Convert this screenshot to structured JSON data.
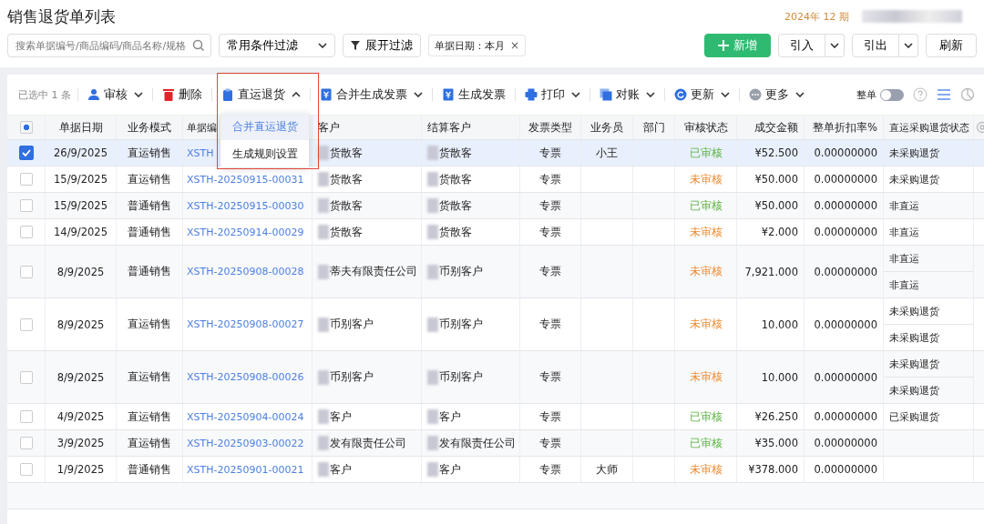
{
  "title": "销售退货单列表",
  "period": "2024年 12 期",
  "search": {
    "placeholder": "搜索单据编号/商品编码/商品名称/规格"
  },
  "filter_select": "常用条件过滤",
  "expand_filter": "展开过滤",
  "filter_tag": "单据日期：本月",
  "tag_close": "×",
  "buttons": [
    {
      "label": "新增",
      "kind": "primary"
    },
    {
      "label": "引入",
      "kind": "split"
    },
    {
      "label": "引出",
      "kind": "split"
    },
    {
      "label": "刷新",
      "kind": "plain"
    }
  ],
  "selection_count": "已选中 1 条",
  "actions": [
    {
      "label": "审核",
      "dropdown": true,
      "expanded": false
    },
    {
      "label": "删除",
      "dropdown": false
    },
    {
      "label": "直运退货",
      "dropdown": true,
      "expanded": true
    },
    {
      "label": "合并生成发票",
      "dropdown": true,
      "expanded": false
    },
    {
      "label": "生成发票",
      "dropdown": false
    },
    {
      "label": "打印",
      "dropdown": true,
      "expanded": false
    },
    {
      "label": "对账",
      "dropdown": true,
      "expanded": false
    },
    {
      "label": "更新",
      "dropdown": true,
      "expanded": false
    },
    {
      "label": "更多",
      "dropdown": true,
      "expanded": false
    }
  ],
  "whole_toggle": {
    "label": "整单",
    "on": false
  },
  "menu": [
    {
      "label": "合并直运退货",
      "selected": true
    },
    {
      "label": "生成规则设置",
      "selected": false
    }
  ],
  "select_all": {
    "indeterminate": true
  },
  "columns": [
    "单据日期",
    "业务模式",
    "单据编",
    "客户",
    "结算客户",
    "发票类型",
    "业务员",
    "部门",
    "审核状态",
    "成交金额",
    "整单折扣率%",
    "直运采购退货状态"
  ],
  "rows": [
    {
      "checked": true,
      "date": "26/9/2025",
      "mode": "直运销售",
      "number": "XSTH",
      "customer": "货散客",
      "settle": "货散客",
      "invoice": "专票",
      "salesman": "小王",
      "audit": "已审核",
      "audited": true,
      "amount": "¥52.500",
      "discount": "0.00000000",
      "return_status": [
        "未采购退货"
      ]
    },
    {
      "checked": false,
      "date": "15/9/2025",
      "mode": "直运销售",
      "number": "XSTH-20250915-00031",
      "customer": "货散客",
      "settle": "货散客",
      "invoice": "专票",
      "audit": "未审核",
      "audited": false,
      "amount": "¥50.000",
      "discount": "0.00000000",
      "return_status": [
        "未采购退货"
      ]
    },
    {
      "checked": false,
      "date": "15/9/2025",
      "mode": "普通销售",
      "number": "XSTH-20250915-00030",
      "customer": "货散客",
      "settle": "货散客",
      "invoice": "专票",
      "audit": "已审核",
      "audited": true,
      "amount": "¥50.000",
      "discount": "0.00000000",
      "return_status": [
        "非直运"
      ]
    },
    {
      "checked": false,
      "date": "14/9/2025",
      "mode": "普通销售",
      "number": "XSTH-20250914-00029",
      "customer": "货散客",
      "settle": "货散客",
      "invoice": "专票",
      "audit": "未审核",
      "audited": false,
      "amount": "¥2.000",
      "discount": "0.00000000",
      "return_status": [
        "非直运"
      ]
    },
    {
      "checked": false,
      "date": "8/9/2025",
      "mode": "普通销售",
      "number": "XSTH-20250908-00028",
      "customer": "蒂夫有限责任公司",
      "settle": "币别客户",
      "invoice": "专票",
      "audit": "未审核",
      "audited": false,
      "amount": "7,921.000",
      "discount": "0.00000000",
      "return_status": [
        "非直运",
        "非直运"
      ]
    },
    {
      "checked": false,
      "date": "8/9/2025",
      "mode": "直运销售",
      "number": "XSTH-20250908-00027",
      "customer": "币别客户",
      "settle": "币别客户",
      "invoice": "专票",
      "audit": "未审核",
      "audited": false,
      "amount": "10.000",
      "discount": "0.00000000",
      "return_status": [
        "未采购退货",
        "未采购退货"
      ]
    },
    {
      "checked": false,
      "date": "8/9/2025",
      "mode": "直运销售",
      "number": "XSTH-20250908-00026",
      "customer": "币别客户",
      "settle": "币别客户",
      "invoice": "专票",
      "audit": "未审核",
      "audited": false,
      "amount": "10.000",
      "discount": "0.00000000",
      "return_status": [
        "未采购退货",
        "未采购退货"
      ]
    },
    {
      "checked": false,
      "date": "4/9/2025",
      "mode": "直运销售",
      "number": "XSTH-20250904-00024",
      "customer": "客户",
      "settle": "客户",
      "invoice": "专票",
      "audit": "已审核",
      "audited": true,
      "amount": "¥26.250",
      "discount": "0.00000000",
      "return_status": [
        "已采购退货"
      ]
    },
    {
      "checked": false,
      "date": "3/9/2025",
      "mode": "直运销售",
      "number": "XSTH-20250903-00022",
      "customer": "发有限责任公司",
      "settle": "发有限责任公司",
      "invoice": "专票",
      "audit": "已审核",
      "audited": true,
      "amount": "¥35.000",
      "discount": "0.00000000"
    },
    {
      "checked": false,
      "date": "1/9/2025",
      "mode": "普通销售",
      "number": "XSTH-20250901-00021",
      "customer": "客户",
      "settle": "客户",
      "invoice": "专票",
      "salesman": "大师",
      "audit": "未审核",
      "audited": false,
      "amount": "¥378.000",
      "discount": "0.00000000"
    }
  ]
}
